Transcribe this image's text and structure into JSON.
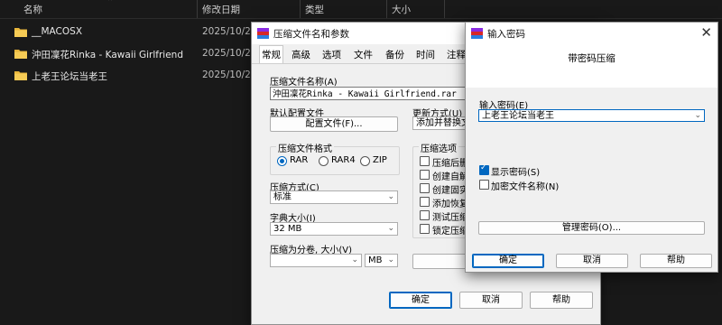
{
  "explorer": {
    "columns": {
      "name": "名称",
      "modified": "修改日期",
      "type": "类型",
      "size": "大小"
    },
    "files": [
      {
        "name": "__MACOSX",
        "date": "2025/10/2 2"
      },
      {
        "name": "沖田凜花Rinka - Kawaii Girlfriend",
        "date": "2025/10/2 2"
      },
      {
        "name": "上老王论坛当老王",
        "date": "2025/10/2 2"
      }
    ]
  },
  "archive_dialog": {
    "title": "压缩文件名和参数",
    "tabs": [
      "常规",
      "高级",
      "选项",
      "文件",
      "备份",
      "时间",
      "注释"
    ],
    "archive_name_label": "压缩文件名称(A)",
    "archive_name_value": "沖田凜花Rinka - Kawaii Girlfriend.rar",
    "default_profile_label": "默认配置文件",
    "profiles_button": "配置文件(F)...",
    "update_mode_label": "更新方式(U)",
    "update_mode_value": "添加并替换文",
    "format_group": "压缩文件格式",
    "formats": [
      "RAR",
      "RAR4",
      "ZIP"
    ],
    "method_label": "压缩方式(C)",
    "method_value": "标准",
    "dict_label": "字典大小(I)",
    "dict_value": "32 MB",
    "split_label": "压缩为分卷, 大小(V)",
    "split_unit": "MB",
    "options_group": "压缩选项",
    "options": [
      "压缩后删",
      "创建自解",
      "创建固实",
      "添加恢复",
      "测试压缩",
      "锁定压缩"
    ],
    "ok": "确定",
    "cancel": "取消",
    "help": "帮助"
  },
  "password_dialog": {
    "title": "输入密码",
    "subtitle": "带密码压缩",
    "password_label": "输入密码(E)",
    "password_value": "上老王论坛当老王",
    "show_password": "显示密码(S)",
    "show_password_checked": true,
    "encrypt_names": "加密文件名称(N)",
    "encrypt_names_checked": false,
    "manage_button": "管理密码(O)...",
    "ok": "确定",
    "cancel": "取消",
    "help": "帮助"
  }
}
